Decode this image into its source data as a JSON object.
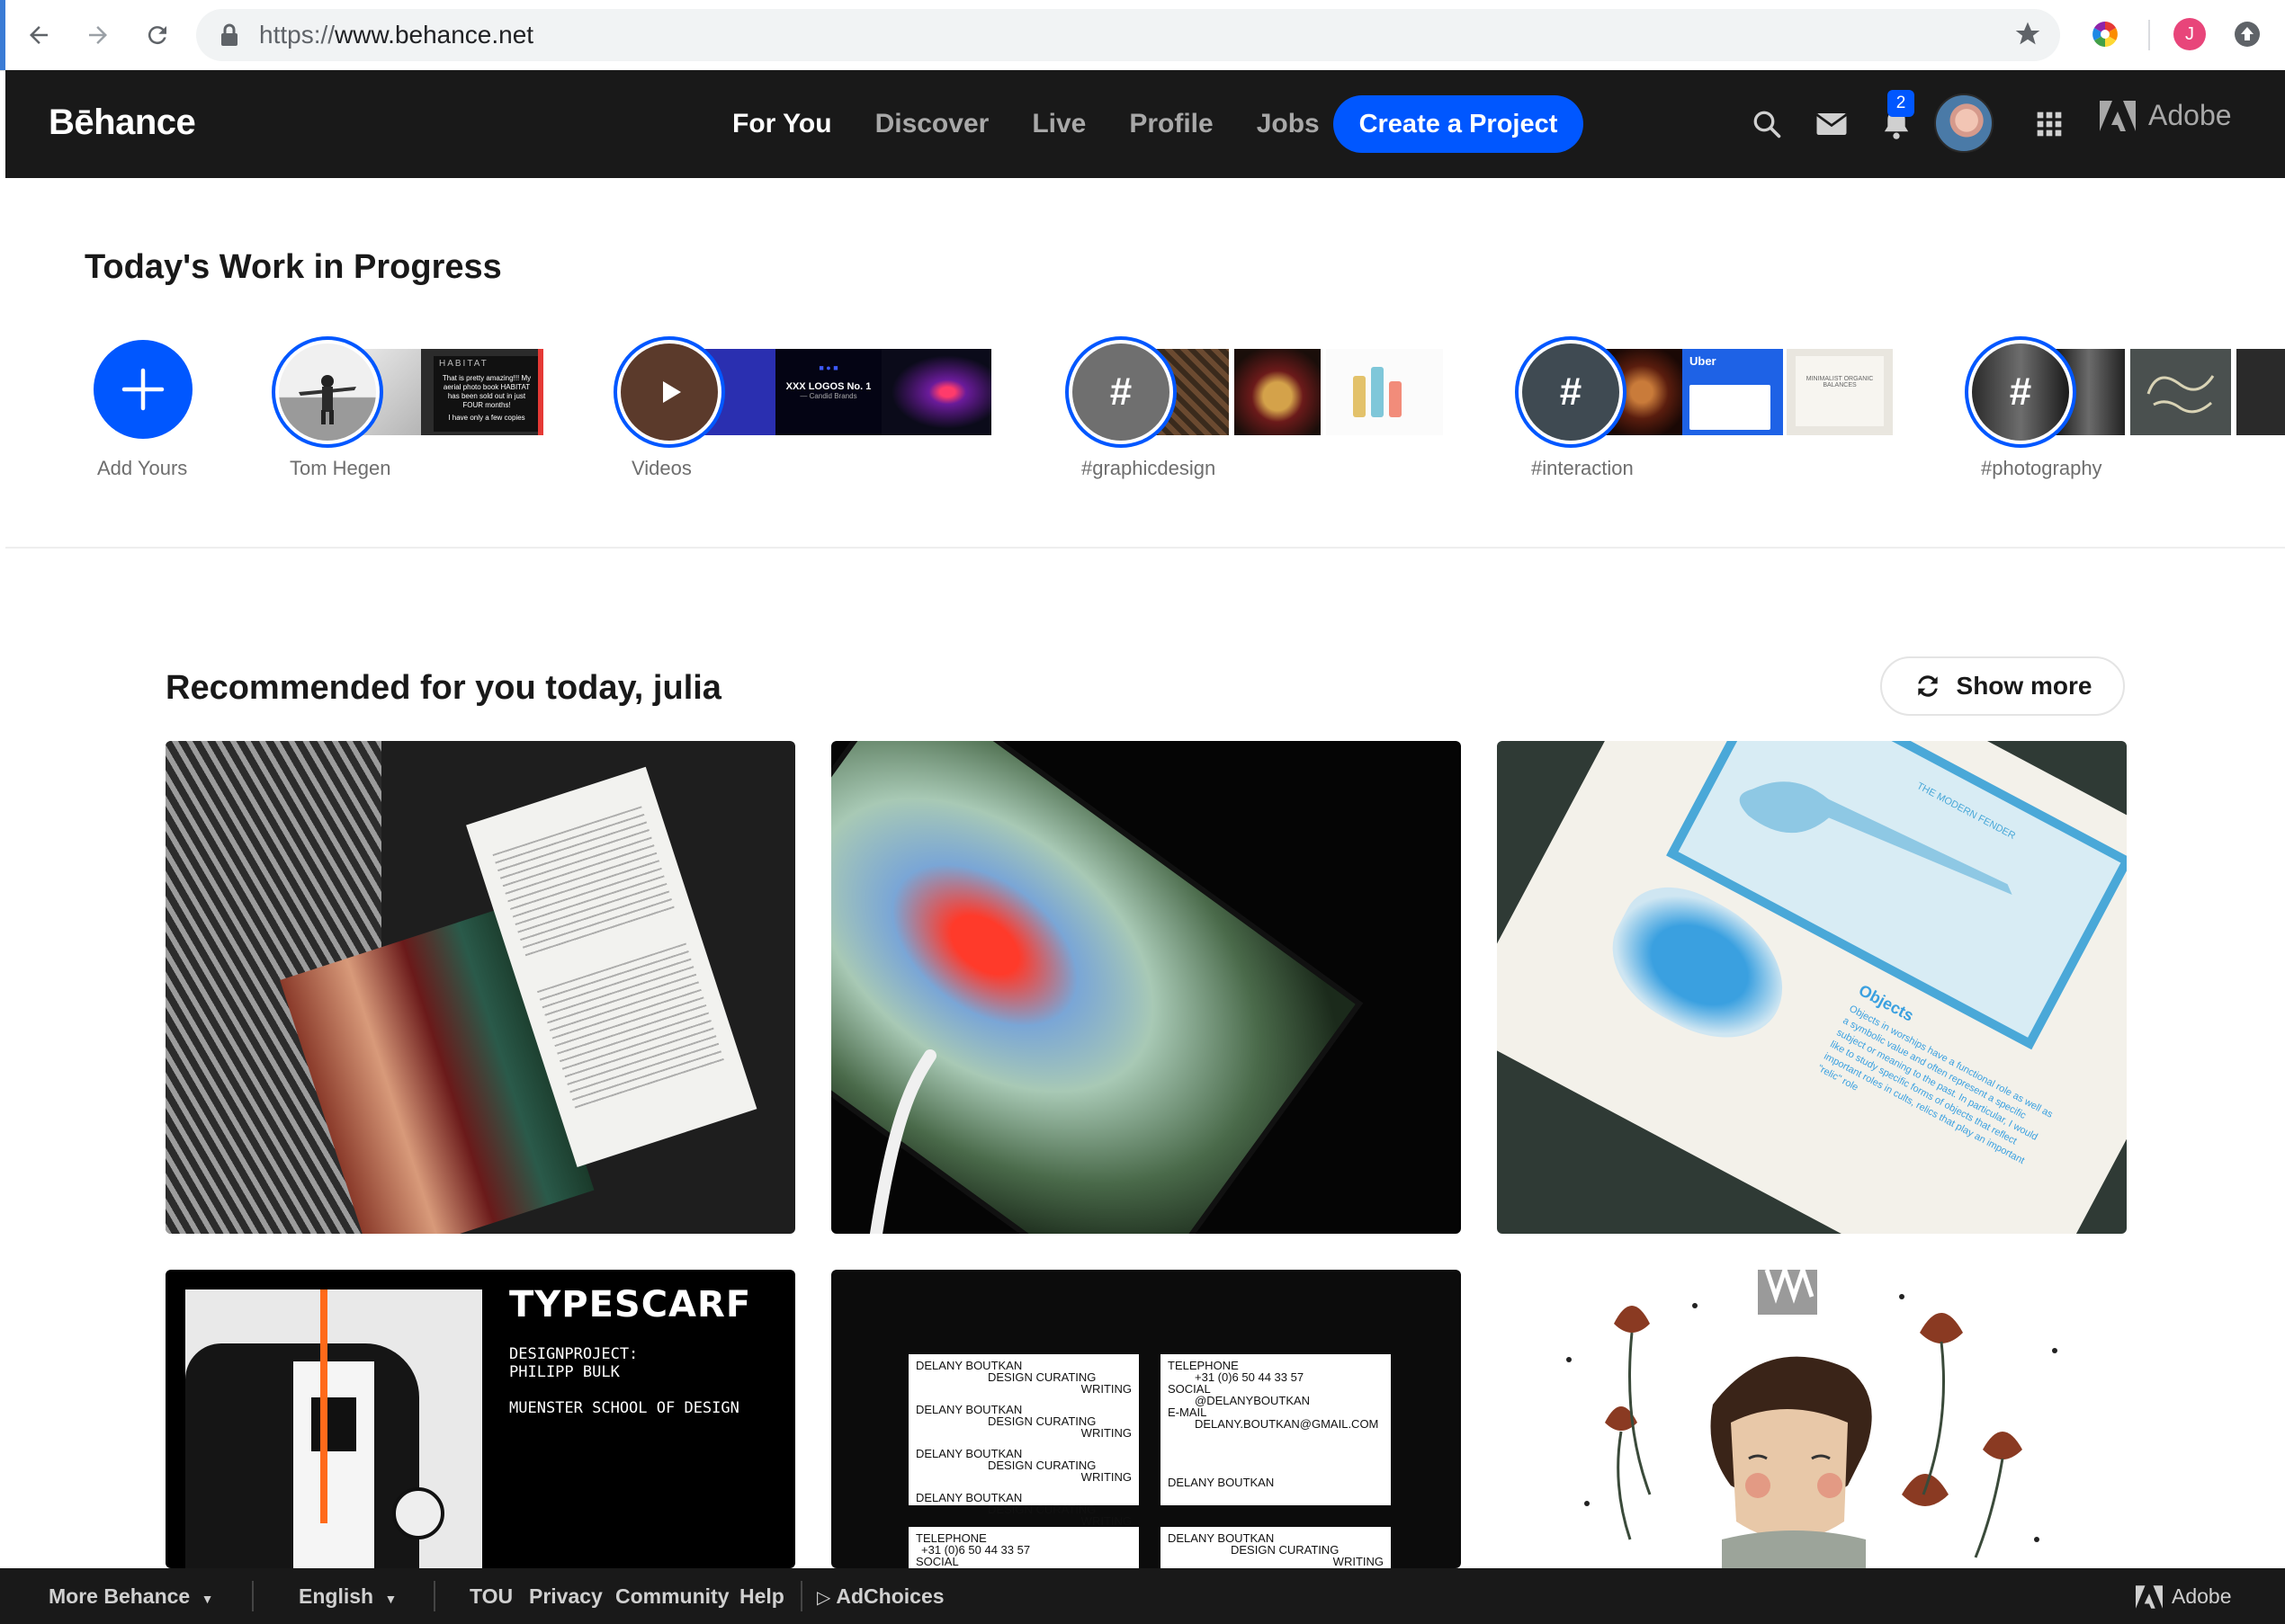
{
  "browser": {
    "url_scheme": "https://",
    "url_host": "www.behance.net",
    "profile_initial": "J"
  },
  "header": {
    "logo": "Bēhance",
    "nav": [
      "For You",
      "Discover",
      "Live",
      "Profile",
      "Jobs"
    ],
    "active_nav": "For You",
    "create_button": "Create a Project",
    "notification_count": "2",
    "adobe_label": "Adobe",
    "colors": {
      "bar": "#191919",
      "accent": "#0057ff"
    }
  },
  "wip": {
    "title": "Today's Work in Progress",
    "items": [
      {
        "label": "Add Yours"
      },
      {
        "label": "Tom Hegen"
      },
      {
        "label": "Videos"
      },
      {
        "label": "#graphicdesign"
      },
      {
        "label": "#interaction"
      },
      {
        "label": "#photography"
      }
    ],
    "thumb_texts": {
      "habitat_title": "HABITAT",
      "habitat_body": "That is pretty amazing!!! My aerial photo book HABITAT has been sold out in just FOUR months!",
      "habitat_more": "I have only a few copies",
      "logos_title": "XXX LOGOS No. 1",
      "logos_sub": "— Candid Brands",
      "uber": "Uber",
      "minimalist": "MINIMALIST ORGANIC BALANCES"
    }
  },
  "recommended": {
    "title": "Recommended for you today, julia",
    "show_more": "Show more",
    "card_texts": {
      "typescarf_title": "TYPESCARF",
      "typescarf_line1": "DESIGNPROJECT:",
      "typescarf_line2": "PHILIPP BULK",
      "typescarf_line3": "MUENSTER SCHOOL OF DESIGN",
      "biz_name": "DELANY BOUTKAN",
      "biz_role1": "DESIGN CURATING",
      "biz_role2": "WRITING",
      "biz_tel_label": "TELEPHONE",
      "biz_tel": "+31 (0)6 50 44 33 57",
      "biz_social_label": "SOCIAL",
      "biz_social": "@DELANYBOUTKAN",
      "biz_email_label": "E-MAIL",
      "biz_email": "DELANY.BOUTKAN@GMAIL.COM",
      "book_heading": "Objects",
      "book_body": "Objects in worships have a functional role as well as a symbolic value and often represent a specific subject or meaning to the past. In particular, I would like to study specific forms of objects that reflect important roles in cults, relics that play an important \"relic\" role",
      "guitar_plaque": "THE MODERN FENDER"
    }
  },
  "footer": {
    "more_behance": "More Behance",
    "language": "English",
    "links": [
      "TOU",
      "Privacy",
      "Community",
      "Help"
    ],
    "adchoices": "AdChoices",
    "adobe": "Adobe"
  }
}
